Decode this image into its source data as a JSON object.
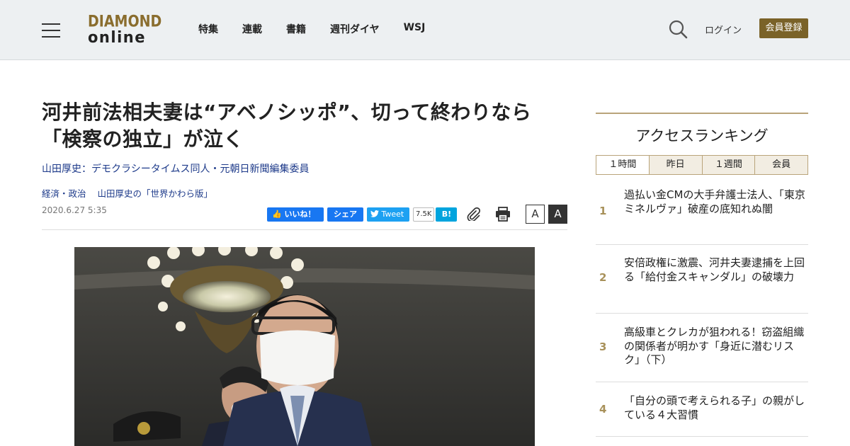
{
  "header": {
    "logo_line1": "DIAMOND",
    "logo_line2": "online",
    "nav": [
      "特集",
      "連載",
      "書籍",
      "週刊ダイヤ",
      "WSJ"
    ],
    "login": "ログイン",
    "register": "会員登録"
  },
  "article": {
    "title_line1": "河井前法相夫妻は“アベノシッポ”、切って終わりなら",
    "title_line2": "「検察の独立」が泣く",
    "author": "山田厚史：デモクラシータイムス同人・元朝日新聞編集委員",
    "tags": [
      "経済・政治",
      "山田厚史の「世界かわら版」"
    ],
    "date": "2020.6.27 5:35",
    "share": {
      "like": "いいね！",
      "fb_share": "シェア",
      "tweet": "Tweet",
      "count": "7.5K",
      "hatena": "B!"
    },
    "font_small": "A",
    "font_large": "A"
  },
  "ranking": {
    "title": "アクセスランキング",
    "tabs": [
      "１時間",
      "昨日",
      "１週間",
      "会員"
    ],
    "items": [
      {
        "num": "1",
        "text": "過払い金CMの大手弁護士法人、「東京ミネルヴァ」破産の底知れぬ闇"
      },
      {
        "num": "2",
        "text": "安倍政権に激震、河井夫妻逮捕を上回る「給付金スキャンダル」の破壊力"
      },
      {
        "num": "3",
        "text": "高級車とクレカが狙われる！窃盗組織の関係者が明かす「身近に潜むリスク」（下）"
      },
      {
        "num": "4",
        "text": "「自分の頭で考えられる子」の親がしている４大習慣"
      }
    ]
  },
  "colors": {
    "accent_gold": "#7a6228",
    "rank_gold": "#a8915a",
    "link_blue": "#1d3a8a"
  }
}
